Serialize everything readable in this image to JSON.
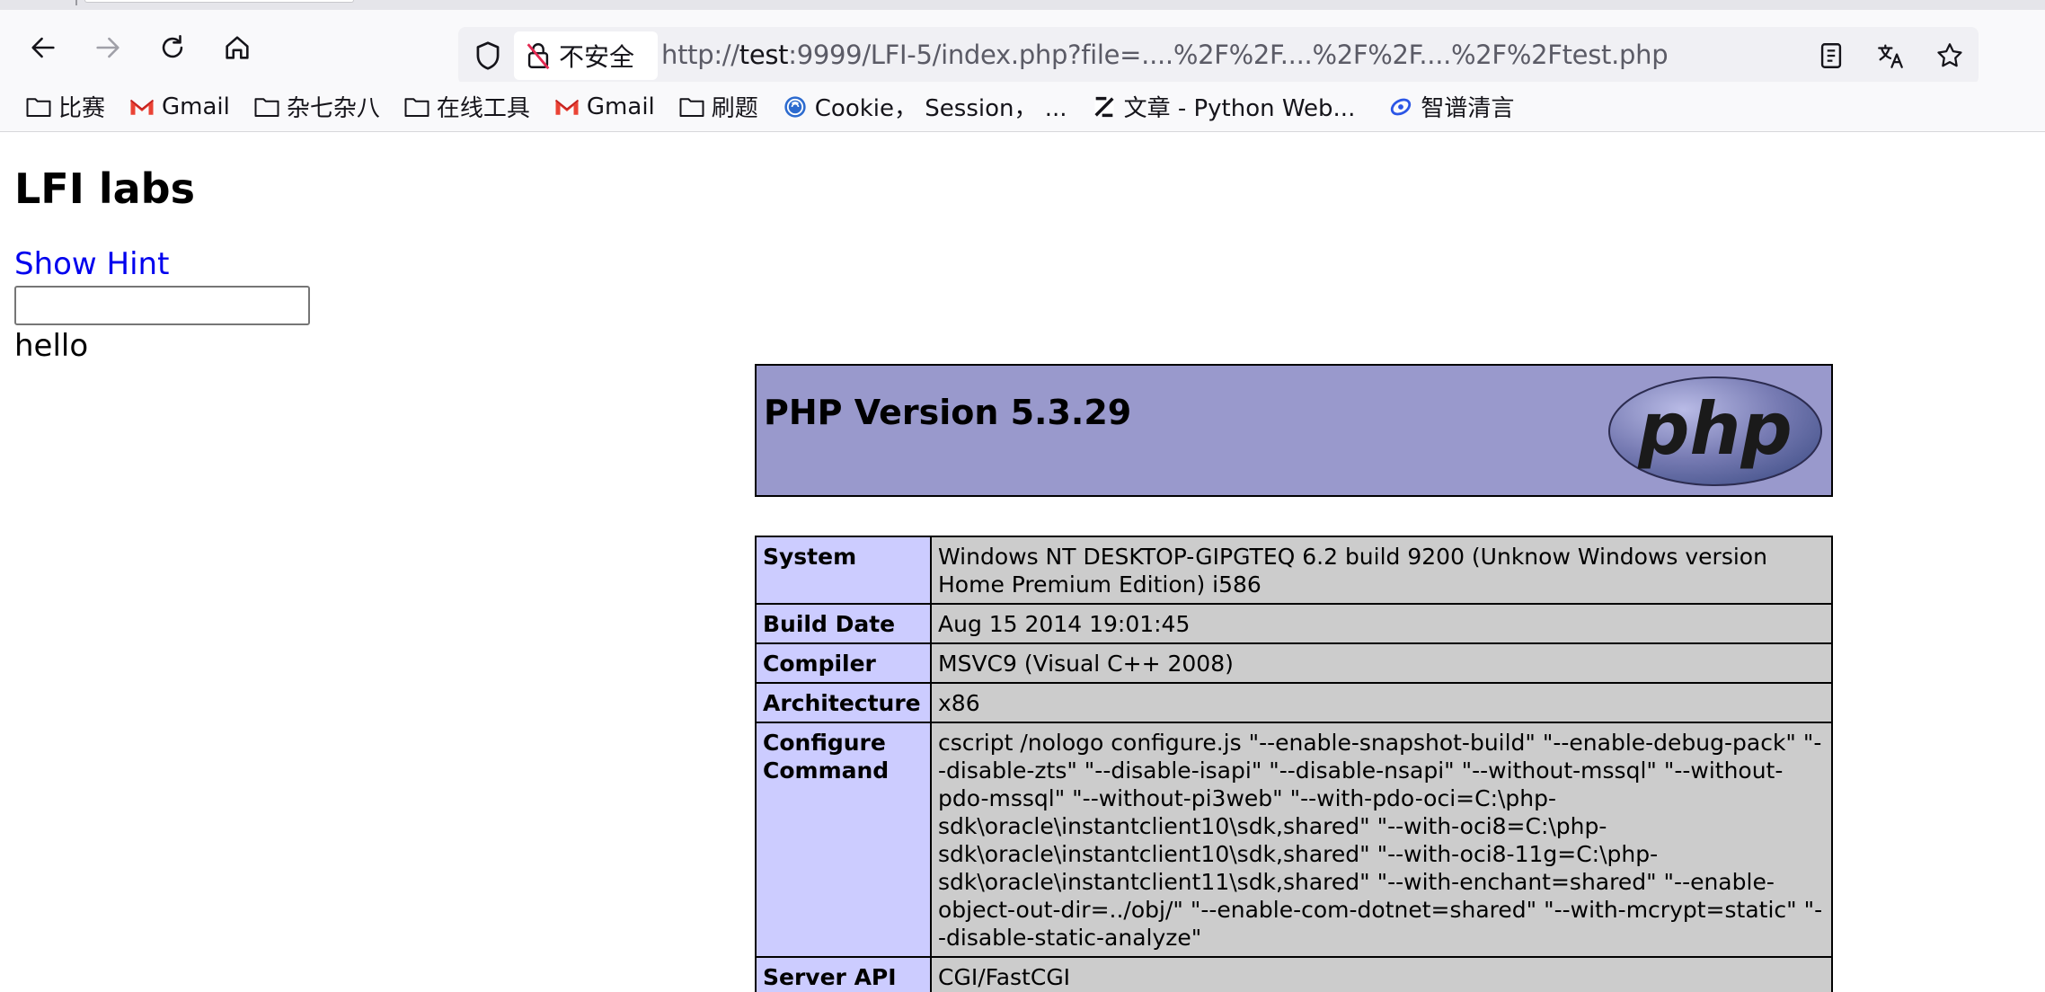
{
  "browser": {
    "url_prefix": "http://",
    "url_host": "test",
    "url_rest": ":9999/LFI-5/index.php?file=....%2F%2F....%2F%2F....%2F%2Ftest.php",
    "security_label": "不安全",
    "icons": {
      "back": "back-arrow-icon",
      "forward": "forward-arrow-icon",
      "reload": "reload-icon",
      "home": "home-icon",
      "shield": "shield-icon",
      "insecure": "insecure-lock-icon",
      "reader": "reader-view-icon",
      "translate": "translate-icon",
      "bookmark": "star-icon"
    }
  },
  "bookmarks": [
    {
      "label": "比赛",
      "icon": "folder-icon"
    },
    {
      "label": "Gmail",
      "icon": "gmail-icon"
    },
    {
      "label": "杂七杂八",
      "icon": "folder-icon"
    },
    {
      "label": "在线工具",
      "icon": "folder-icon"
    },
    {
      "label": "Gmail",
      "icon": "gmail-icon"
    },
    {
      "label": "刷题",
      "icon": "folder-icon"
    },
    {
      "label": "Cookie， Session， ...",
      "icon": "site-icon"
    },
    {
      "label": "文章 - Python Web...",
      "icon": "zhihu-icon"
    },
    {
      "label": "智谱清言",
      "icon": "zhipu-icon"
    }
  ],
  "page": {
    "title": "LFI labs",
    "hint_link": "Show Hint",
    "input_value": "",
    "output_text": "hello"
  },
  "phpinfo": {
    "version": "PHP Version 5.3.29",
    "logo_text": "php",
    "rows": [
      {
        "key": "System",
        "value": "Windows NT DESKTOP-GIPGTEQ 6.2 build 9200 (Unknow Windows version Home Premium Edition) i586"
      },
      {
        "key": "Build Date",
        "value": "Aug 15 2014 19:01:45"
      },
      {
        "key": "Compiler",
        "value": "MSVC9 (Visual C++ 2008)"
      },
      {
        "key": "Architecture",
        "value": "x86"
      },
      {
        "key": "Configure Command",
        "value": "cscript /nologo configure.js \"--enable-snapshot-build\" \"--enable-debug-pack\" \"--disable-zts\" \"--disable-isapi\" \"--disable-nsapi\" \"--without-mssql\" \"--without-pdo-mssql\" \"--without-pi3web\" \"--with-pdo-oci=C:\\php-sdk\\oracle\\instantclient10\\sdk,shared\" \"--with-oci8=C:\\php-sdk\\oracle\\instantclient10\\sdk,shared\" \"--with-oci8-11g=C:\\php-sdk\\oracle\\instantclient11\\sdk,shared\" \"--with-enchant=shared\" \"--enable-object-out-dir=../obj/\" \"--enable-com-dotnet=shared\" \"--with-mcrypt=static\" \"--disable-static-analyze\""
      },
      {
        "key": "Server API",
        "value": "CGI/FastCGI"
      }
    ]
  },
  "colors": {
    "php_header_bg": "#9999cc",
    "key_cell_bg": "#ccccff",
    "value_cell_bg": "#cccccc",
    "link": "#0000ee"
  }
}
